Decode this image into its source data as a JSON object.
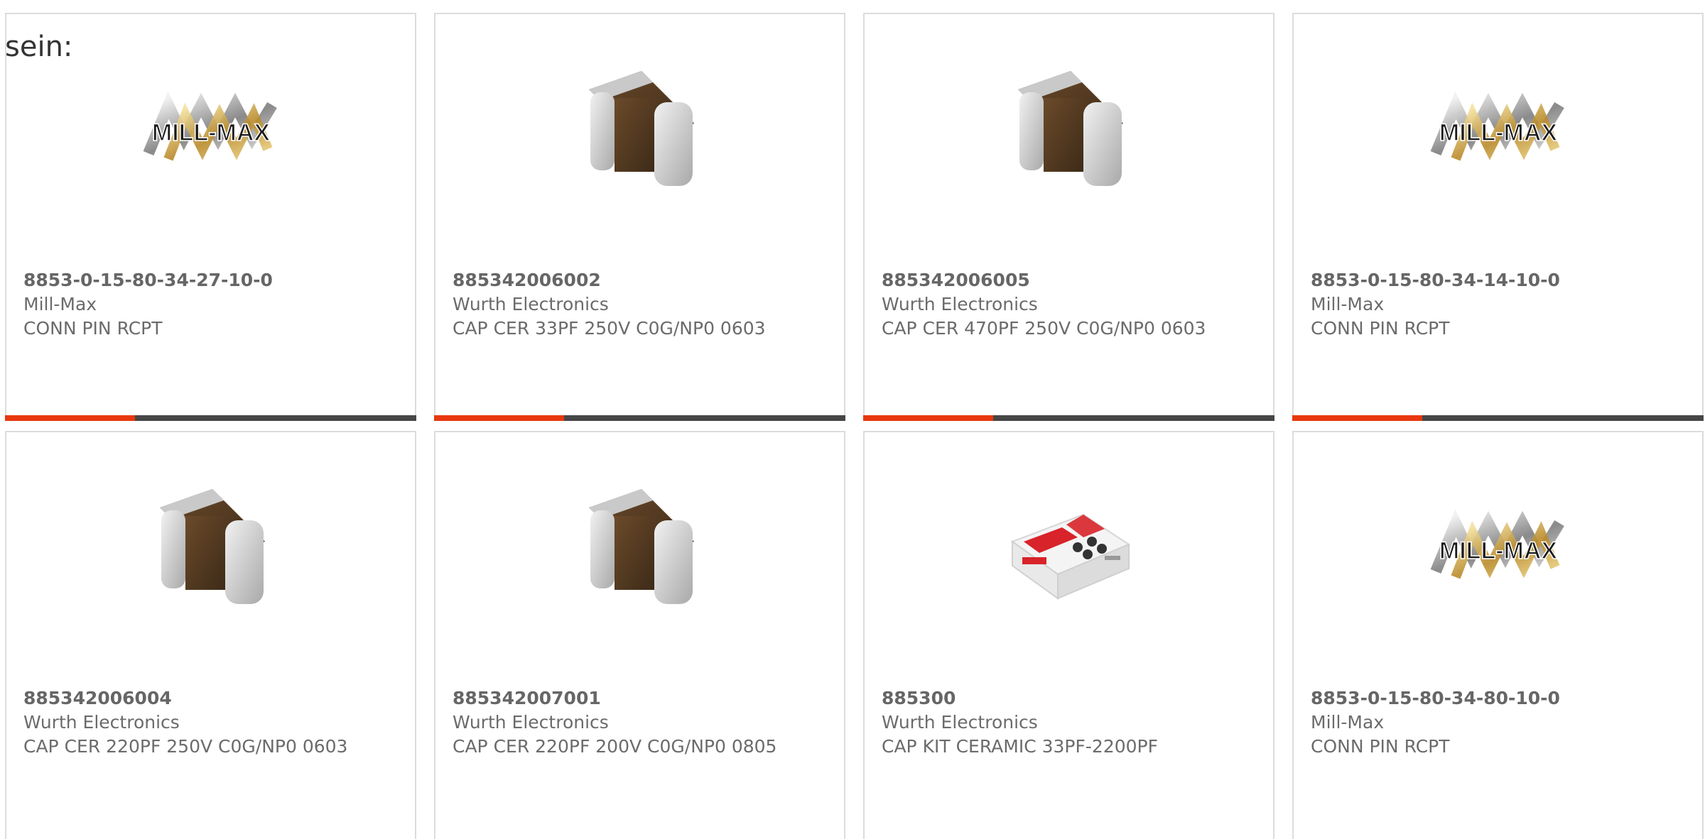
{
  "intro_text": "sein:",
  "accent_color": "#e8380d",
  "bar_color": "#464646",
  "products": [
    {
      "part_number": "8853-0-15-80-34-27-10-0",
      "manufacturer": "Mill-Max",
      "description": "CONN PIN RCPT",
      "image": "mill-max-logo"
    },
    {
      "part_number": "885342006002",
      "manufacturer": "Wurth Electronics",
      "description": "CAP CER 33PF 250V C0G/NP0 0603",
      "image": "chip-capacitor"
    },
    {
      "part_number": "885342006005",
      "manufacturer": "Wurth Electronics",
      "description": "CAP CER 470PF 250V C0G/NP0 0603",
      "image": "chip-capacitor"
    },
    {
      "part_number": "8853-0-15-80-34-14-10-0",
      "manufacturer": "Mill-Max",
      "description": "CONN PIN RCPT",
      "image": "mill-max-logo"
    },
    {
      "part_number": "885342006004",
      "manufacturer": "Wurth Electronics",
      "description": "CAP CER 220PF 250V C0G/NP0 0603",
      "image": "chip-capacitor"
    },
    {
      "part_number": "885342007001",
      "manufacturer": "Wurth Electronics",
      "description": "CAP CER 220PF 200V C0G/NP0 0805",
      "image": "chip-capacitor"
    },
    {
      "part_number": "885300",
      "manufacturer": "Wurth Electronics",
      "description": "CAP KIT CERAMIC 33PF-2200PF",
      "image": "capacitor-kit-box"
    },
    {
      "part_number": "8853-0-15-80-34-80-10-0",
      "manufacturer": "Mill-Max",
      "description": "CONN PIN RCPT",
      "image": "mill-max-logo"
    }
  ],
  "logo_text": "MILL-MAX"
}
